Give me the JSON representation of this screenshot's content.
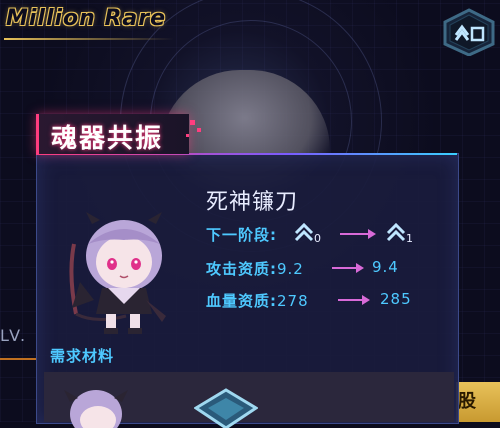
{
  "logo": {
    "text": "Million Rare"
  },
  "side": {
    "level_fragment": "LV."
  },
  "right_button": {
    "label": "股"
  },
  "dialog": {
    "title": "魂器共振",
    "item_name": "死神镰刀",
    "stage": {
      "label": "下一阶段:",
      "from_sub": "0",
      "to_sub": "1"
    },
    "attack": {
      "label": "攻击资质:",
      "from": "9.2",
      "to": "9.4"
    },
    "hp": {
      "label": "血量资质:",
      "from": "278",
      "to": "285"
    },
    "required_materials": "需求材料"
  },
  "icons": [
    "hex-rank-button-icon",
    "rank-chevron-icon",
    "arrow-right-icon",
    "chibi-character-icon",
    "material-hex-icon"
  ],
  "colors": {
    "accent_pink": "#ff3d7f",
    "label_blue": "#4ec9ff",
    "logo_gold": "#e8c25a",
    "arrow_magenta": "#d86ad8"
  }
}
